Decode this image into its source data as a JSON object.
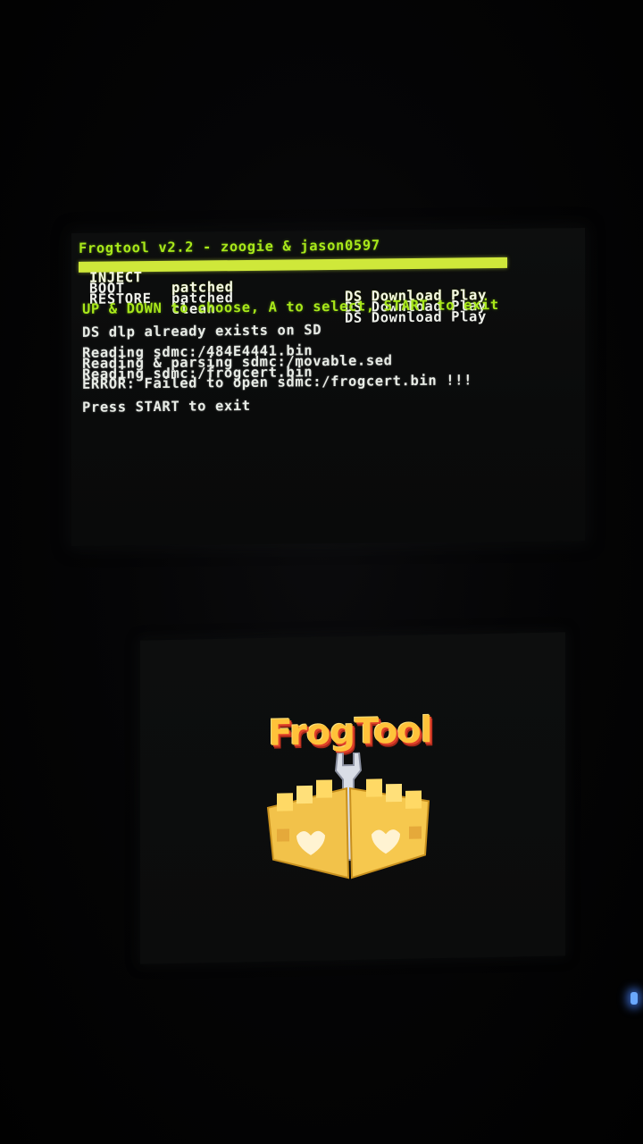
{
  "top_screen": {
    "title": "Frogtool v2.2 - zoogie & jason0597",
    "menu": [
      {
        "option": "INJECT",
        "state": "patched",
        "target": "DS Download Play",
        "selected": true
      },
      {
        "option": "BOOT",
        "state": "patched",
        "target": "DS Download Play",
        "selected": false
      },
      {
        "option": "RESTORE",
        "state": "clean",
        "target": "DS Download Play",
        "selected": false
      }
    ],
    "instructions": "UP & DOWN to choose, A to select, START to exit",
    "status": "DS dlp already exists on SD",
    "log": [
      "Reading sdmc:/484E4441.bin",
      "Reading & parsing sdmc:/movable.sed",
      "Reading sdmc:/frogcert.bin",
      "ERROR: Failed to open sdmc:/frogcert.bin !!!"
    ],
    "prompt": "Press START to exit"
  },
  "bottom_screen": {
    "logo_text": "FrogTool",
    "logo_icon": "frogtool-crate-wrench-icon"
  },
  "colors": {
    "accent_green": "#a8e81a",
    "selection_bar": "#cfe83a",
    "logo_gold": "#ffc23a",
    "led_blue": "#6aa8ff"
  }
}
